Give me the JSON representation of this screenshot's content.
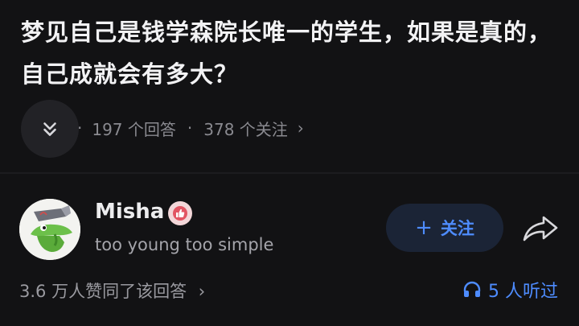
{
  "question": {
    "title": "梦见自己是钱学森院长唯一的学生，如果是真的，自己成就会有多大？",
    "answers_count": "197 个回答",
    "followers_count": "378 个关注",
    "separator": "·",
    "chevron": "›"
  },
  "author": {
    "name": "Misha",
    "bio": "too young too simple",
    "badge_icon": "thumbs-up-badge-icon",
    "avatar_icon": "crocodile-avatar-icon"
  },
  "actions": {
    "follow_label": "关注",
    "follow_plus": "+",
    "share_icon": "share-icon"
  },
  "footer": {
    "likes_text": "3.6 万人赞同了该回答",
    "chevron": "›",
    "listeners_text": "5 人听过",
    "listeners_icon": "headphones-icon"
  },
  "colors": {
    "background": "#121214",
    "accent": "#4e8cff",
    "follow_bg": "#1b2436"
  }
}
